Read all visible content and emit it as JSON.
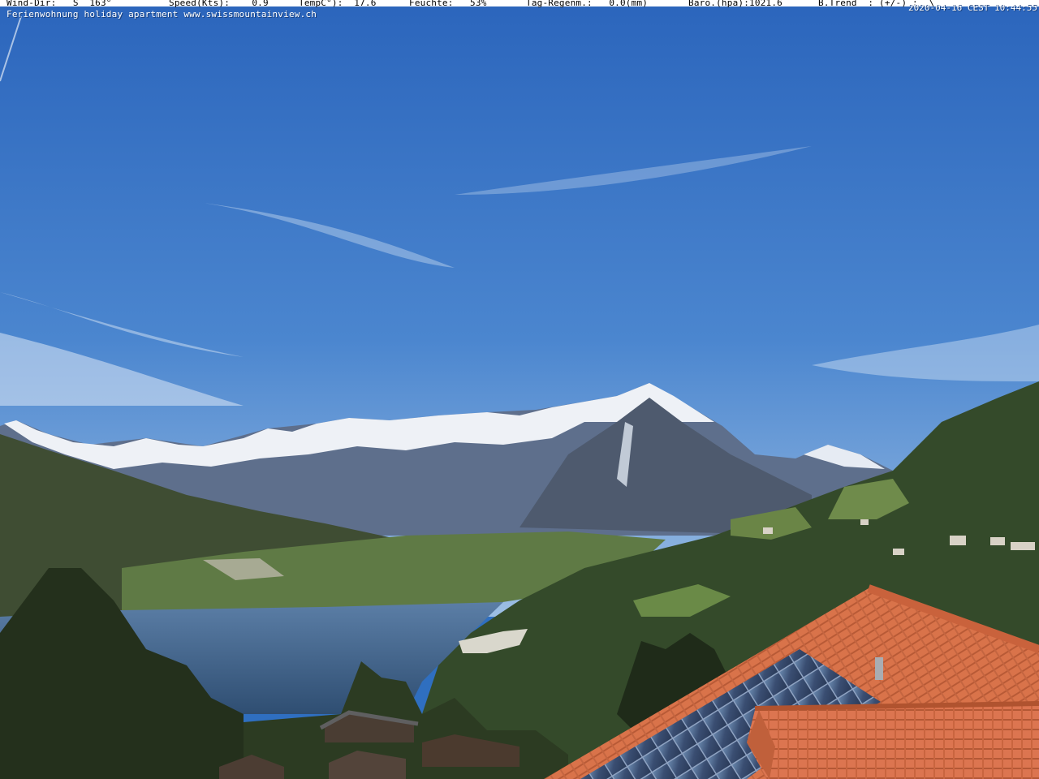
{
  "overlay": {
    "wind_dir": "Wind-Dir:   S  163°",
    "speed": "Speed(Kts):    0.9",
    "temp": "TempC°):  17.6",
    "humidity": "Feuchte:   53%",
    "rain": "Tag-Regenm.:   0.0(mm)",
    "baro": "Baro.(hpa):1021.6",
    "trend": "B.Trend  : (+/-) :  \\",
    "caption": "Ferienwohnung holiday apartment www.swissmountainview.ch",
    "timestamp": "2020-04-16 CEST 10:44:55"
  },
  "scene": {
    "sky_top": "#2c67bd",
    "sky_bottom": "#8fb4e0",
    "lake": "#3d5f86",
    "roof_tiles": "#d8724a",
    "solar_panel": "#3b4d6e",
    "snow": "#f2f4f8",
    "forest": "#2c3d25"
  }
}
